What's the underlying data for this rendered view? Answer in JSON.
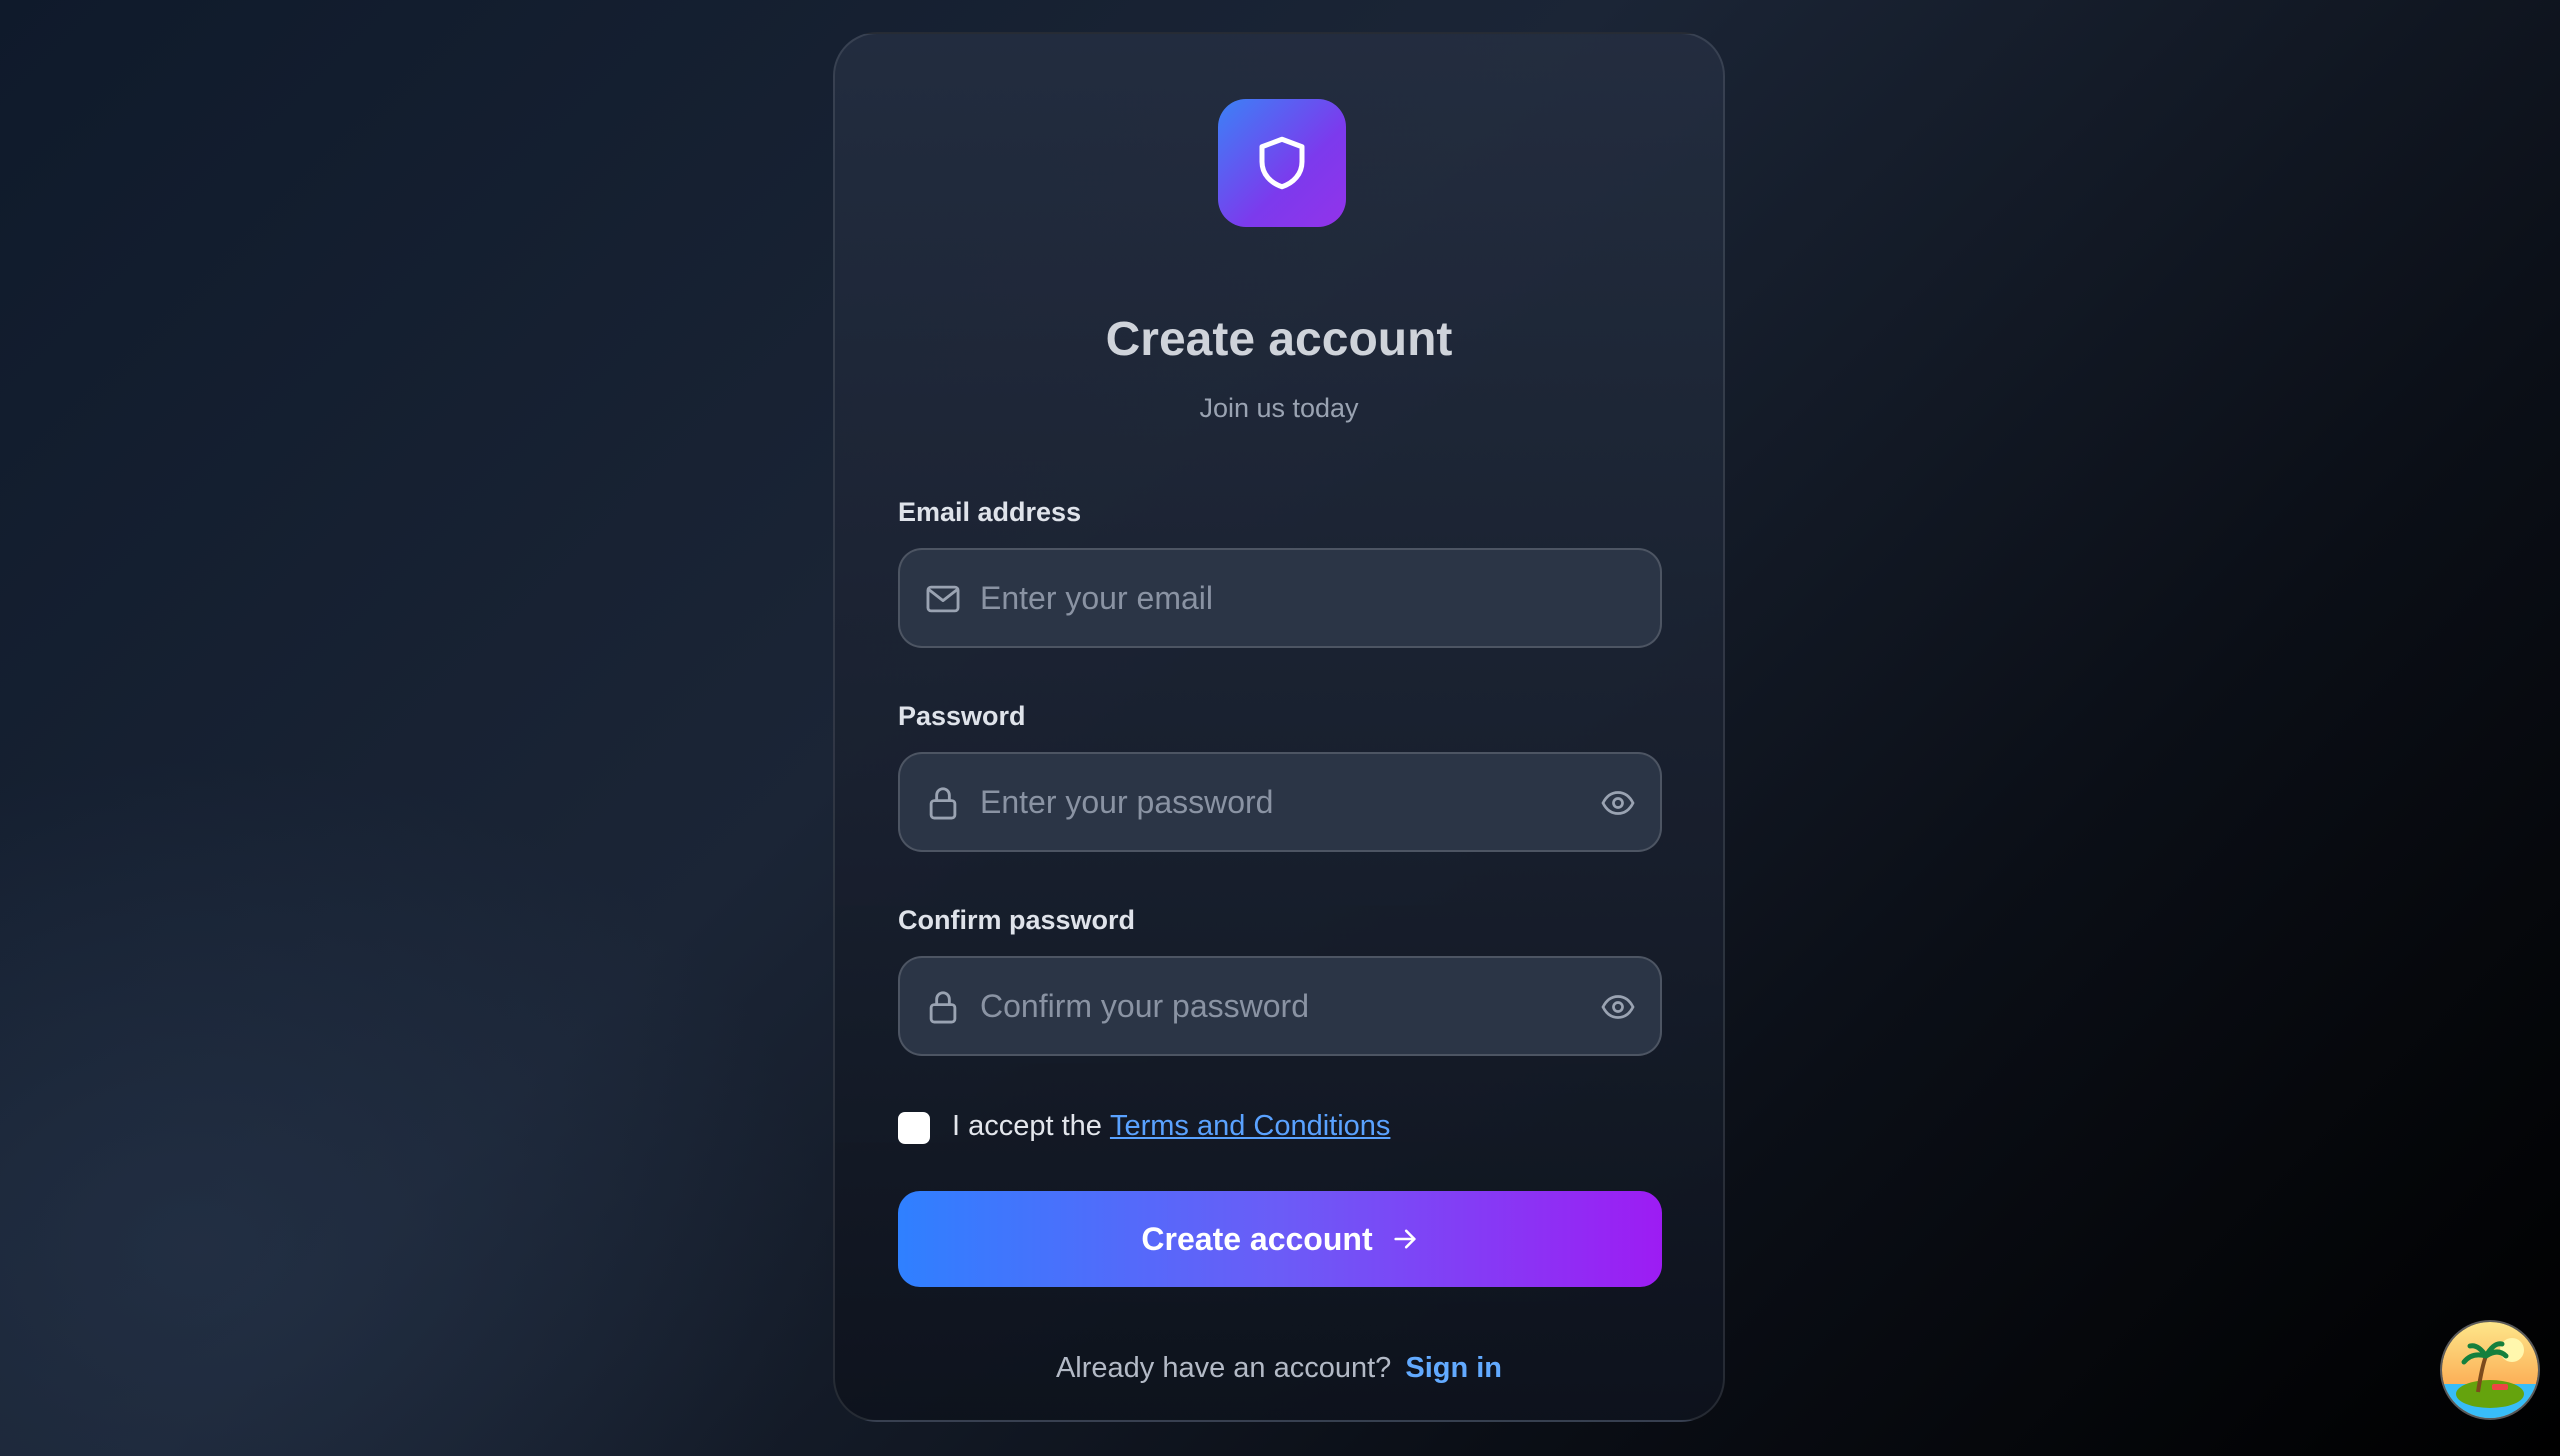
{
  "form": {
    "title": "Create account",
    "subtitle": "Join us today",
    "email": {
      "label": "Email address",
      "placeholder": "Enter your email",
      "icon": "mail-icon"
    },
    "password": {
      "label": "Password",
      "placeholder": "Enter your password",
      "icon": "lock-icon",
      "toggle_icon": "eye-icon"
    },
    "confirm": {
      "label": "Confirm password",
      "placeholder": "Confirm your password",
      "icon": "lock-icon",
      "toggle_icon": "eye-icon"
    },
    "terms": {
      "prefix": "I accept the",
      "link": "Terms and Conditions",
      "checked": false
    },
    "submit_label": "Create account",
    "footer": {
      "text": "Already have an account?",
      "link": "Sign in"
    }
  },
  "colors": {
    "accent_start": "#2f80ff",
    "accent_end": "#9d1cf3",
    "link": "#5aa2ff"
  }
}
